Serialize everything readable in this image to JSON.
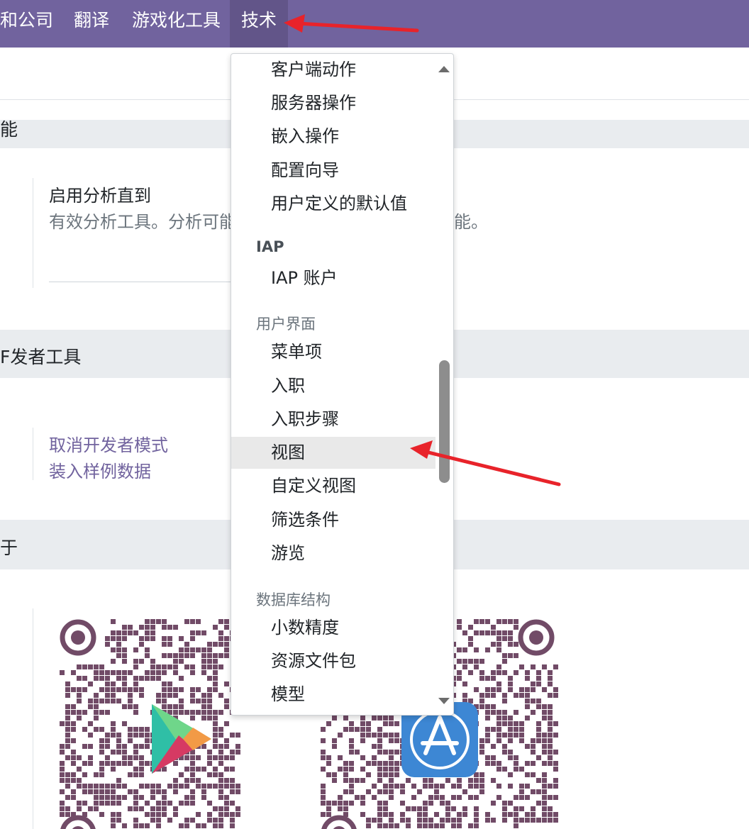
{
  "nav": {
    "items": [
      "和公司",
      "翻译",
      "游戏化工具",
      "技术"
    ]
  },
  "sections": {
    "features_title": "能",
    "analytics": {
      "title": "启用分析直到",
      "desc_left": "有效分析工具。分析可能",
      "desc_right": "能。"
    },
    "dev_title": "F发者工具",
    "dev_links": [
      "取消开发者模式",
      "装入样例数据"
    ],
    "about_title": "于"
  },
  "dropdown": {
    "items_top": [
      "客户端动作",
      "服务器操作",
      "嵌入操作",
      "配置向导",
      "用户定义的默认值"
    ],
    "iap_header": "IAP",
    "iap_items": [
      "IAP 账户"
    ],
    "ui_header": "用户界面",
    "ui_items": [
      "菜单项",
      "入职",
      "入职步骤",
      "视图",
      "自定义视图",
      "筛选条件",
      "游览"
    ],
    "db_header": "数据库结构",
    "db_items": [
      "小数精度",
      "资源文件包",
      "模型"
    ],
    "highlighted": "视图"
  },
  "colors": {
    "navbar": "#71639e",
    "link": "#71639e",
    "qr": "#714b67",
    "annotation_arrow": "#e8232a",
    "appstore_blue": "#3d87d4"
  },
  "icons": {
    "left_qr_logo": "google-play-icon",
    "right_qr_logo": "app-store-icon"
  }
}
